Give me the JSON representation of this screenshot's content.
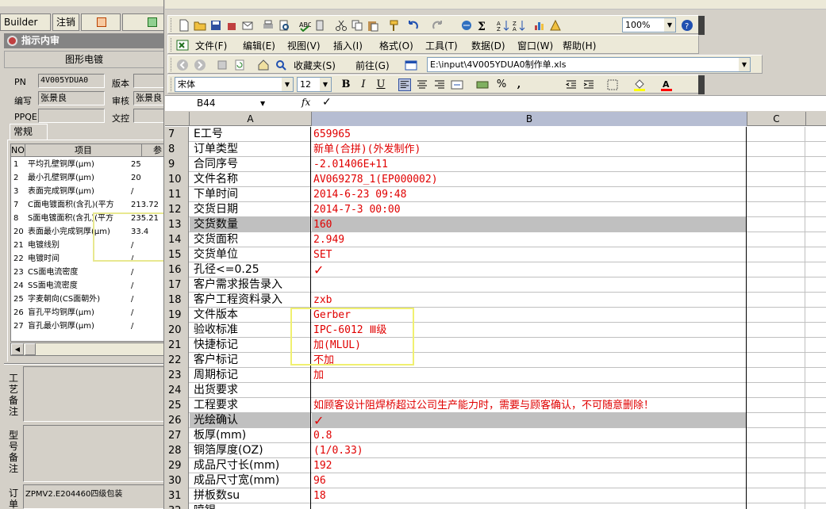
{
  "left_panel": {
    "tabs": [
      "Builder",
      "注销"
    ],
    "title": "指示内审",
    "subtitle": "图形电镀",
    "fields": {
      "pn_label": "PN",
      "pn_value": "4V005YDUA0",
      "version_label": "版本",
      "version_value": "",
      "author_label": "编写",
      "author_value": "张景良",
      "reviewer_label": "审核",
      "reviewer_value": "张景良",
      "ppqe_label": "PPQE",
      "ppqe_value": "",
      "wenkong_label": "文控",
      "wenkong_value": ""
    },
    "inner_tab": "常规",
    "grid_headers": [
      "NO",
      "项目",
      "参"
    ],
    "grid_rows": [
      {
        "no": "1",
        "name": "平均孔壁铜厚(μm)",
        "val": "25"
      },
      {
        "no": "2",
        "name": "最小孔壁铜厚(μm)",
        "val": "20"
      },
      {
        "no": "3",
        "name": "表面完成铜厚(μm)",
        "val": "/"
      },
      {
        "no": "7",
        "name": "C面电镀面积(含孔)(平方",
        "val": "213.72"
      },
      {
        "no": "8",
        "name": "S面电镀面积(含孔)(平方",
        "val": "235.21"
      },
      {
        "no": "20",
        "name": "表面最小完成铜厚(μm)",
        "val": "33.4"
      },
      {
        "no": "21",
        "name": "电镀线别",
        "val": "/"
      },
      {
        "no": "22",
        "name": "电镀时间",
        "val": "/"
      },
      {
        "no": "23",
        "name": "CS面电流密度",
        "val": "/"
      },
      {
        "no": "24",
        "name": "SS面电流密度",
        "val": "/"
      },
      {
        "no": "25",
        "name": "字麦朝向(CS面朝外)",
        "val": "/"
      },
      {
        "no": "26",
        "name": "盲孔平均铜厚(μm)",
        "val": "/"
      },
      {
        "no": "27",
        "name": "盲孔最小铜厚(μm)",
        "val": "/"
      }
    ],
    "memo1_label": "工艺备注",
    "memo2_label": "型号备注",
    "memo3_label": "订单",
    "memo3_value": "ZPMV2.E204460四级包装"
  },
  "excel": {
    "menu": [
      "文件(F)",
      "编辑(E)",
      "视图(V)",
      "插入(I)",
      "格式(O)",
      "工具(T)",
      "数据(D)",
      "窗口(W)",
      "帮助(H)"
    ],
    "zoom": "100%",
    "favorites": "收藏夹(S)",
    "go": "前往(G)",
    "address": "E:\\input\\4V005YDUA0制作单.xls",
    "font": "宋体",
    "font_size": "12",
    "name_box": "B44",
    "fx": "fx",
    "formula": "✓",
    "columns": [
      "A",
      "B",
      "C"
    ],
    "rows": [
      {
        "n": "7",
        "a": "E工号",
        "b": "659965"
      },
      {
        "n": "8",
        "a": "订单类型",
        "b": "新单(合拼)(外发制作)"
      },
      {
        "n": "9",
        "a": "合同序号",
        "b": "-2.01406E+11"
      },
      {
        "n": "10",
        "a": "文件名称",
        "b": "AV069278_1(EP000002)"
      },
      {
        "n": "11",
        "a": "下单时间",
        "b": "2014-6-23 09:48"
      },
      {
        "n": "12",
        "a": "交货日期",
        "b": "2014-7-3 00:00"
      },
      {
        "n": "13",
        "a": "交货数量",
        "b": "160"
      },
      {
        "n": "14",
        "a": "交货面积",
        "b": "2.949"
      },
      {
        "n": "15",
        "a": "交货单位",
        "b": "SET"
      },
      {
        "n": "16",
        "a": "孔径<=0.25",
        "b": "✓"
      },
      {
        "n": "17",
        "a": "客户需求报告录入",
        "b": ""
      },
      {
        "n": "18",
        "a": "客户工程资料录入",
        "b": "zxb"
      },
      {
        "n": "19",
        "a": "文件版本",
        "b": "Gerber"
      },
      {
        "n": "20",
        "a": "验收标准",
        "b": "IPC-6012 Ⅲ级"
      },
      {
        "n": "21",
        "a": "快捷标记",
        "b": "加(MLUL)"
      },
      {
        "n": "22",
        "a": "客户标记",
        "b": "不加"
      },
      {
        "n": "23",
        "a": "周期标记",
        "b": "加"
      },
      {
        "n": "24",
        "a": "出货要求",
        "b": ""
      },
      {
        "n": "25",
        "a": "工程要求",
        "b": "如顾客设计阻焊桥超过公司生产能力时，需要与顾客确认，不可随意删除！"
      },
      {
        "n": "26",
        "a": "光绘确认",
        "b": "✓"
      },
      {
        "n": "27",
        "a": "板厚(mm)",
        "b": "0.8"
      },
      {
        "n": "28",
        "a": "铜箔厚度(OZ)",
        "b": "(1/0.33)"
      },
      {
        "n": "29",
        "a": "成品尺寸长(mm)",
        "b": "192"
      },
      {
        "n": "30",
        "a": "成品尺寸宽(mm)",
        "b": "96"
      },
      {
        "n": "31",
        "a": "拼板数su",
        "b": "18"
      },
      {
        "n": "32",
        "a": "喷锡",
        "b": ""
      }
    ],
    "gray_rows": [
      "13",
      "26"
    ]
  }
}
